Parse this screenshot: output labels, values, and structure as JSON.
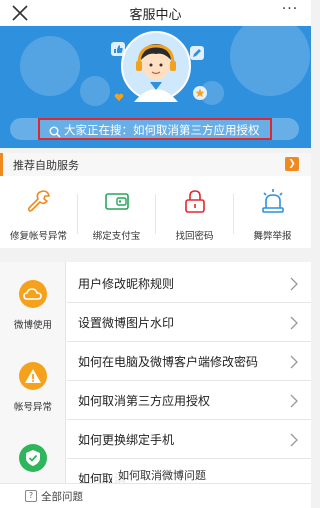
{
  "header": {
    "title": "客服中心",
    "more_label": "···"
  },
  "banner": {
    "search_text": "大家正在搜：如何取消第三方应用授权"
  },
  "recommend": {
    "label": "推荐自助服务"
  },
  "services": [
    {
      "label": "修复帐号异常",
      "icon": "wrench-icon"
    },
    {
      "label": "绑定支付宝",
      "icon": "wallet-icon"
    },
    {
      "label": "找回密码",
      "icon": "lock-icon"
    },
    {
      "label": "舞弊举报",
      "icon": "alarm-icon"
    }
  ],
  "categories": [
    {
      "label": "微博使用",
      "icon": "cloud-icon",
      "color": "#f5a11c"
    },
    {
      "label": "帐号异常",
      "icon": "warning-icon",
      "color": "#f5a11c"
    },
    {
      "label": "",
      "icon": "shield-icon",
      "color": "#2fb55c"
    }
  ],
  "rows": [
    {
      "label": "用户修改昵称规则"
    },
    {
      "label": "设置微博图片水印"
    },
    {
      "label": "如何在电脑及微博客户端修改密码"
    },
    {
      "label": "如何取消第三方应用授权"
    },
    {
      "label": "如何更换绑定手机"
    },
    {
      "label": "如何取消"
    }
  ],
  "tooltip": {
    "label": "如何取消微博问题"
  },
  "bottombar": {
    "label": "全部问题"
  },
  "colors": {
    "banner": "#2f91de",
    "accent": "#f18a1e",
    "highlight": "#e0292d"
  }
}
